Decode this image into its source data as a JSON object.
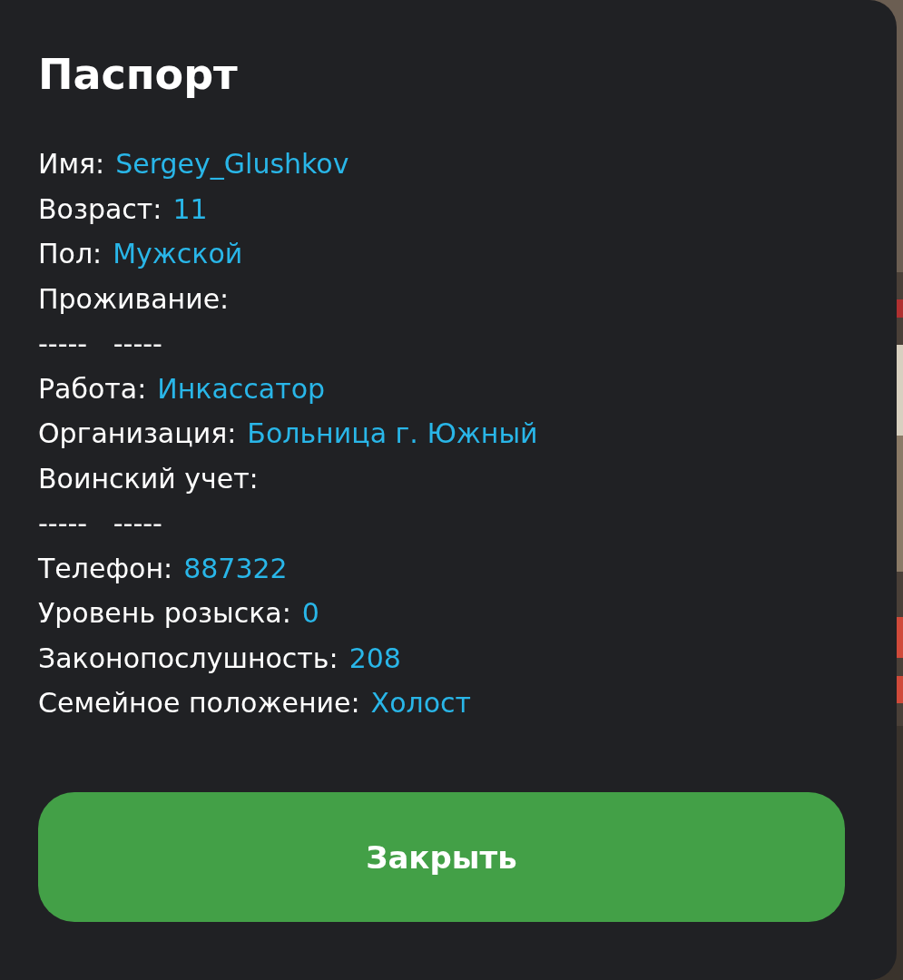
{
  "dialog": {
    "title": "Паспорт",
    "rows": [
      {
        "kind": "field",
        "label": "Имя:",
        "value": "Sergey_Glushkov"
      },
      {
        "kind": "field",
        "label": "Возраст:",
        "value": "11"
      },
      {
        "kind": "field",
        "label": "Пол:",
        "value": "Мужской"
      },
      {
        "kind": "field",
        "label": "Проживание:"
      },
      {
        "kind": "dashes",
        "text": "-----   -----"
      },
      {
        "kind": "field",
        "label": "Работа:",
        "value": "Инкассатор"
      },
      {
        "kind": "field",
        "label": "Организация:",
        "value": "Больница г. Южный"
      },
      {
        "kind": "field",
        "label": "Воинский учет:"
      },
      {
        "kind": "dashes",
        "text": "-----   -----"
      },
      {
        "kind": "field",
        "label": "Телефон:",
        "value": "887322"
      },
      {
        "kind": "field",
        "label": "Уровень розыска:",
        "value": "0"
      },
      {
        "kind": "field",
        "label": "Законопослушность:",
        "value": "208"
      },
      {
        "kind": "field",
        "label": "Семейное положение:",
        "value": "Холост"
      }
    ],
    "close_button": "Закрыть"
  }
}
